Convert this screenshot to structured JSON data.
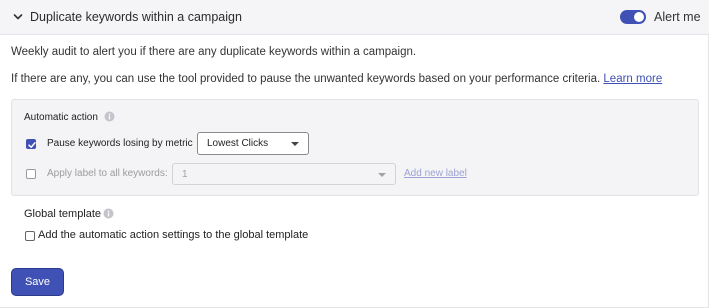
{
  "header": {
    "title": "Duplicate keywords within a campaign",
    "alert_label": "Alert me",
    "alert_enabled": true,
    "collapse_icon": "chevron-down-icon"
  },
  "description": {
    "line1": "Weekly audit to alert you if there are any duplicate keywords within a campaign.",
    "line2": "If there are any, you can use the tool provided to pause the unwanted keywords based on your performance criteria.",
    "learn_more": "Learn more"
  },
  "automatic_action": {
    "title": "Automatic action",
    "info_icon": "info-icon",
    "pause": {
      "checked": true,
      "label": "Pause keywords losing by metric",
      "metric_value": "Lowest Clicks"
    },
    "apply_label": {
      "checked": false,
      "disabled": true,
      "label": "Apply label to all keywords:",
      "value": "1",
      "add_new_label": "Add new label"
    }
  },
  "global_template": {
    "title": "Global template",
    "info_icon": "info-icon",
    "checked": false,
    "label": "Add the automatic action settings to the global template"
  },
  "actions": {
    "save_label": "Save"
  },
  "colors": {
    "accent": "#3f51b5",
    "header_bg": "#f5f5f7",
    "box_bg": "#f4f4f6"
  }
}
